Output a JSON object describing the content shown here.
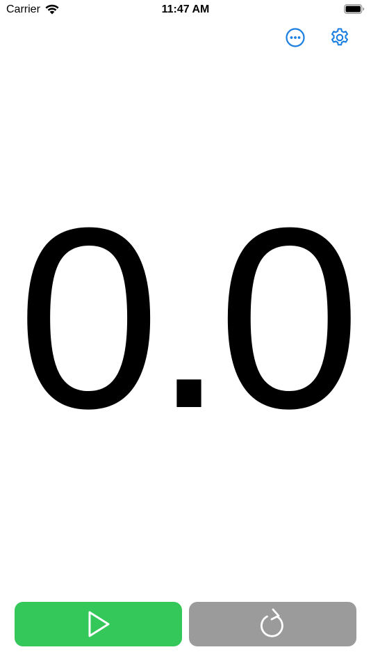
{
  "status_bar": {
    "carrier": "Carrier",
    "time": "11:47 AM",
    "wifi_icon": "wifi-icon",
    "battery_icon": "battery-icon"
  },
  "toolbar": {
    "more_icon": "ellipsis-circle-icon",
    "settings_icon": "gear-icon",
    "accent_color": "#1a7fe0"
  },
  "timer": {
    "display": "0.0"
  },
  "controls": {
    "start_icon": "play-icon",
    "start_color": "#34c759",
    "reset_icon": "reset-icon",
    "reset_color": "#9b9b9b"
  }
}
